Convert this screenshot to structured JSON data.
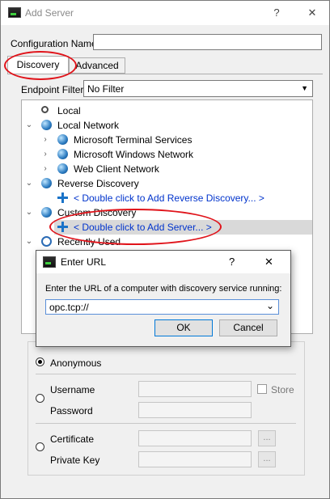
{
  "window": {
    "title": "Add Server",
    "help_btn": "?",
    "close_btn": "✕"
  },
  "config": {
    "label": "Configuration Name",
    "value": ""
  },
  "tabs": [
    {
      "label": "Discovery",
      "active": true
    },
    {
      "label": "Advanced",
      "active": false
    }
  ],
  "filter": {
    "label": "Endpoint Filter:",
    "value": "No Filter",
    "arrow": "▼"
  },
  "tree": [
    {
      "label": "Local",
      "expander": ""
    },
    {
      "label": "Local Network",
      "expander": "⌄"
    },
    {
      "label": "Microsoft Terminal Services",
      "expander": "›"
    },
    {
      "label": "Microsoft Windows Network",
      "expander": "›"
    },
    {
      "label": "Web Client Network",
      "expander": "›"
    },
    {
      "label": "Reverse Discovery",
      "expander": "⌄"
    },
    {
      "label": "< Double click to Add Reverse Discovery... >",
      "expander": ""
    },
    {
      "label": "Custom Discovery",
      "expander": "⌄"
    },
    {
      "label": "< Double click to Add Server... >",
      "expander": ""
    },
    {
      "label": "Recently Used",
      "expander": "⌄"
    }
  ],
  "auth": {
    "anonymous": "Anonymous",
    "username": "Username",
    "password": "Password",
    "store": "Store",
    "certificate": "Certificate",
    "private_key": "Private Key",
    "browse": "..."
  },
  "dialog": {
    "title": "Enter URL",
    "help_btn": "?",
    "close_btn": "✕",
    "prompt": "Enter the URL of a computer with discovery service running:",
    "url_value": "opc.tcp://",
    "dropdown_arrow": "⌄",
    "ok": "OK",
    "cancel": "Cancel"
  },
  "colors": {
    "highlight_ellipse": "#e0141b",
    "link": "#0033cc",
    "selection": "#d9d9d9"
  }
}
